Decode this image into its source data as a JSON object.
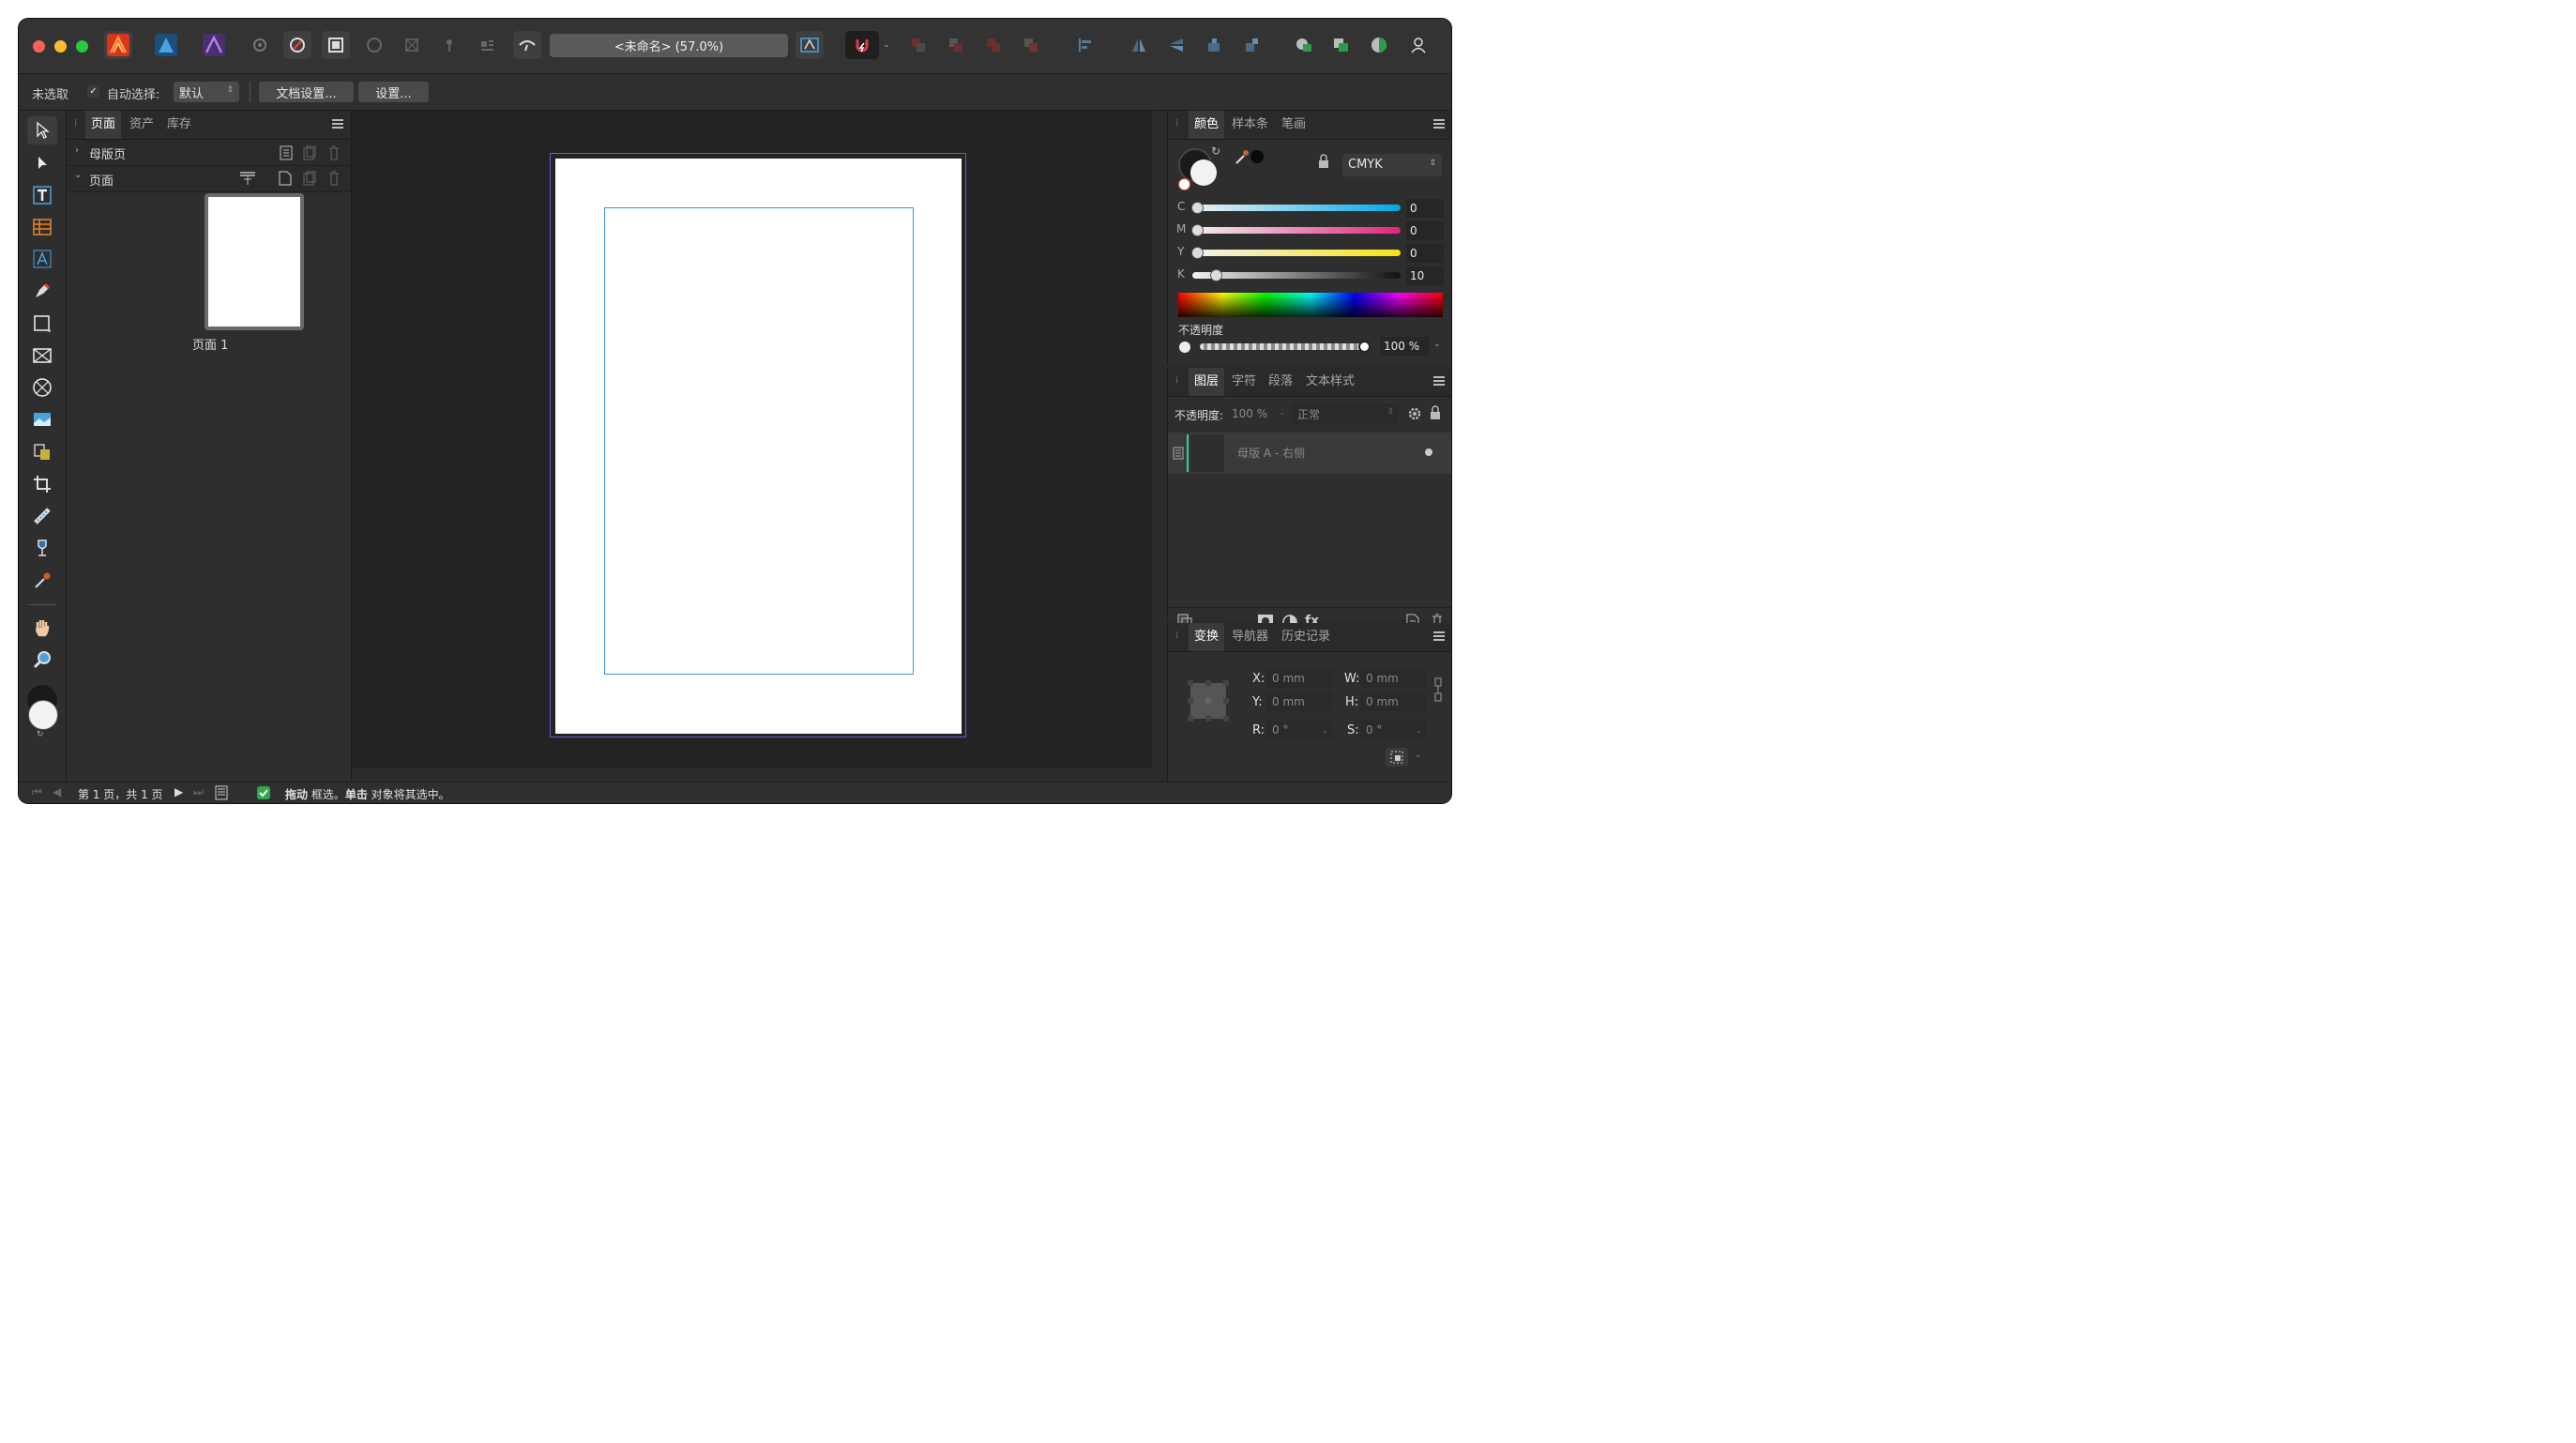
{
  "window": {
    "title": "<未命名> (57.0%)"
  },
  "context_bar": {
    "selection_status": "未选取",
    "auto_select_label": "自动选择:",
    "auto_select_value": "默认",
    "doc_setup_button": "文档设置...",
    "settings_button": "设置..."
  },
  "pages_panel": {
    "tabs": [
      "页面",
      "资产",
      "库存"
    ],
    "master_section": "母版页",
    "pages_section": "页面",
    "page_thumb_label": "页面 1"
  },
  "color_panel": {
    "tabs": [
      "颜色",
      "样本条",
      "笔画"
    ],
    "model": "CMYK",
    "channels": [
      {
        "label": "C",
        "value": "0"
      },
      {
        "label": "M",
        "value": "0"
      },
      {
        "label": "Y",
        "value": "0"
      },
      {
        "label": "K",
        "value": "10"
      }
    ],
    "opacity_label": "不透明度",
    "opacity_value": "100 %"
  },
  "layers_panel": {
    "tabs": [
      "图层",
      "字符",
      "段落",
      "文本样式"
    ],
    "opacity_label": "不透明度:",
    "opacity_value": "100 %",
    "blend_mode": "正常",
    "layer_name": "母版 A - 右侧"
  },
  "transform_panel": {
    "tabs": [
      "变换",
      "导航器",
      "历史记录"
    ],
    "x_label": "X:",
    "x_value": "0 mm",
    "y_label": "Y:",
    "y_value": "0 mm",
    "w_label": "W:",
    "w_value": "0 mm",
    "h_label": "H:",
    "h_value": "0 mm",
    "r_label": "R:",
    "r_value": "0 °",
    "s_label": "S:",
    "s_value": "0 °"
  },
  "status_bar": {
    "page_info": "第 1 页，共 1 页",
    "hint_drag": "拖动",
    "hint_text1": " 框选。",
    "hint_click": "单击",
    "hint_text2": " 对象将其选中。"
  },
  "colors": {
    "accent": "#2f8fd8",
    "margin_guide": "#3d8fe0",
    "brand_red": "#e8452c"
  }
}
